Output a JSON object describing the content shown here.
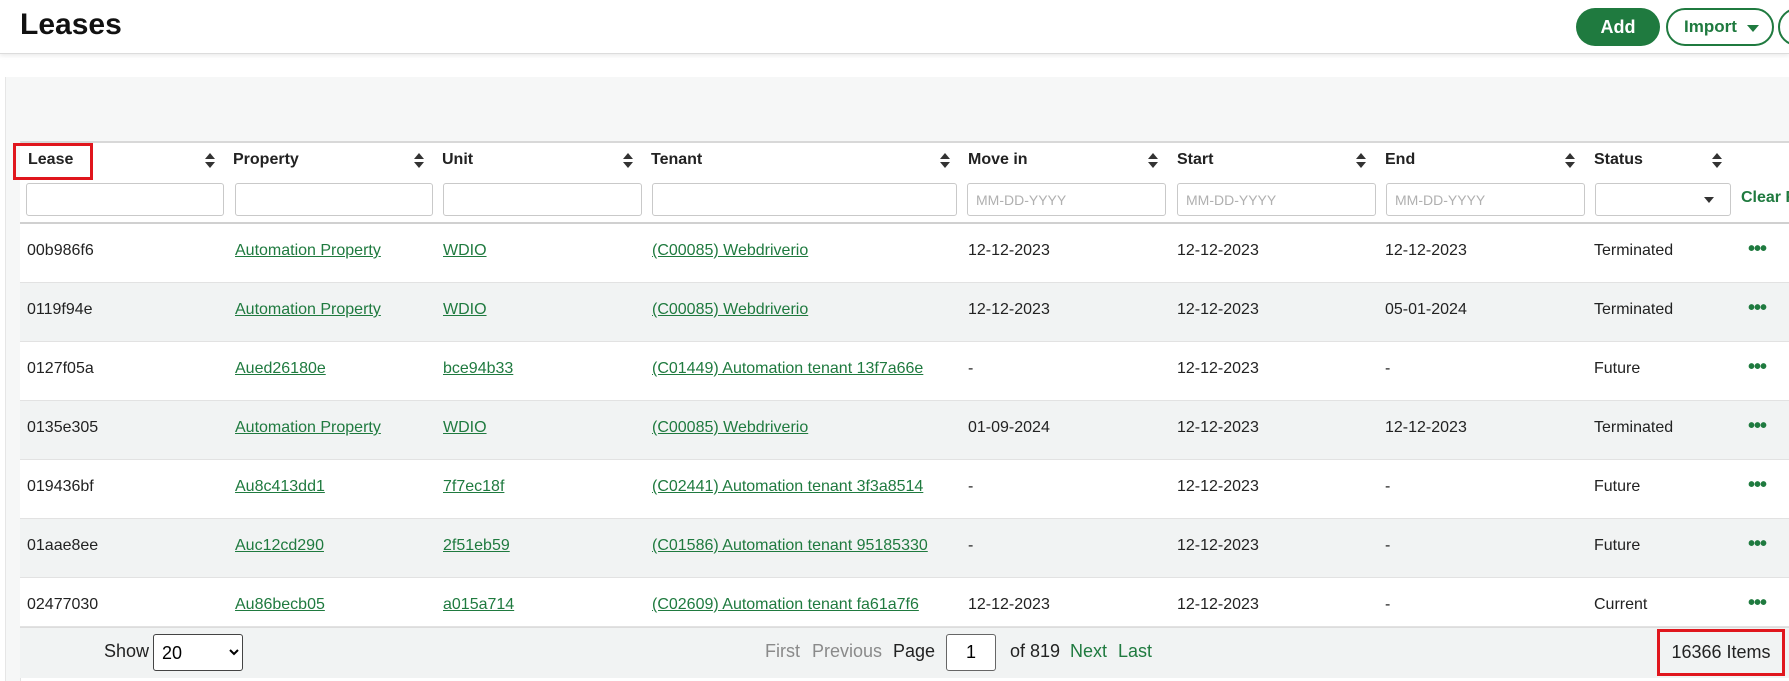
{
  "page": {
    "title": "Leases"
  },
  "toolbar": {
    "add_label": "Add",
    "import_label": "Import"
  },
  "columns": [
    "Lease",
    "Property",
    "Unit",
    "Tenant",
    "Move in",
    "Start",
    "End",
    "Status"
  ],
  "filters": {
    "date_placeholder": "MM-DD-YYYY",
    "clear_label": "Clear Filters",
    "status_selected": ""
  },
  "rows": [
    {
      "lease": "00b986f6",
      "property": "Automation Property",
      "unit": "WDIO",
      "tenant": "(C00085) Webdriverio",
      "move_in": "12-12-2023",
      "start": "12-12-2023",
      "end": "12-12-2023",
      "status": "Terminated"
    },
    {
      "lease": "0119f94e",
      "property": "Automation Property",
      "unit": "WDIO",
      "tenant": "(C00085) Webdriverio",
      "move_in": "12-12-2023",
      "start": "12-12-2023",
      "end": "05-01-2024",
      "status": "Terminated"
    },
    {
      "lease": "0127f05a",
      "property": "Aued26180e",
      "unit": "bce94b33",
      "tenant": "(C01449) Automation tenant 13f7a66e",
      "move_in": "-",
      "start": "12-12-2023",
      "end": "-",
      "status": "Future"
    },
    {
      "lease": "0135e305",
      "property": "Automation Property",
      "unit": "WDIO",
      "tenant": "(C00085) Webdriverio",
      "move_in": "01-09-2024",
      "start": "12-12-2023",
      "end": "12-12-2023",
      "status": "Terminated"
    },
    {
      "lease": "019436bf",
      "property": "Au8c413dd1",
      "unit": "7f7ec18f",
      "tenant": "(C02441) Automation tenant 3f3a8514",
      "move_in": "-",
      "start": "12-12-2023",
      "end": "-",
      "status": "Future"
    },
    {
      "lease": "01aae8ee",
      "property": "Auc12cd290",
      "unit": "2f51eb59",
      "tenant": "(C01586) Automation tenant 95185330",
      "move_in": "-",
      "start": "12-12-2023",
      "end": "-",
      "status": "Future"
    },
    {
      "lease": "02477030",
      "property": "Au86becb05",
      "unit": "a015a714",
      "tenant": "(C02609) Automation tenant fa61a7f6",
      "move_in": "12-12-2023",
      "start": "12-12-2023",
      "end": "-",
      "status": "Current"
    }
  ],
  "row_menu_glyph": "•••",
  "pagination": {
    "show_label": "Show",
    "page_size": "20",
    "page_size_options": [
      "20"
    ],
    "first": "First",
    "previous": "Previous",
    "page_label": "Page",
    "current_page": "1",
    "of_label": "of 819",
    "next": "Next",
    "last": "Last",
    "items_count": "16366 Items"
  },
  "colors": {
    "brand": "#1f7a3f",
    "highlight": "#e0161d"
  }
}
